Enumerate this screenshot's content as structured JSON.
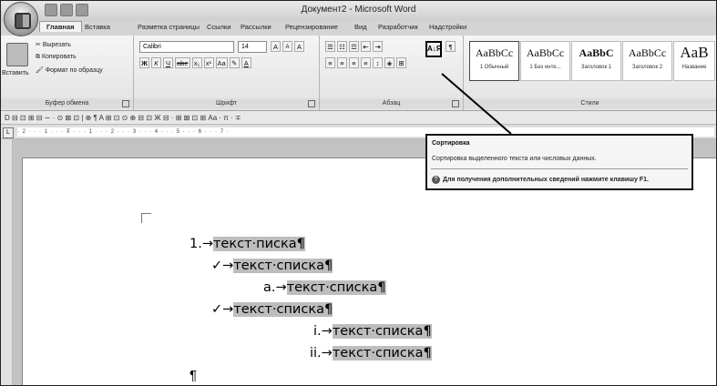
{
  "window": {
    "title": "Документ2 - Microsoft Word"
  },
  "tabs": [
    "Главная",
    "Вставка",
    "Разметка страницы",
    "Ссылки",
    "Рассылки",
    "Рецензирование",
    "Вид",
    "Разработчик",
    "Надстройки"
  ],
  "clipboard": {
    "paste": "Вставить",
    "cut": "Вырезать",
    "copy": "Копировать",
    "format_painter": "Формат по образцу",
    "label": "Буфер обмена"
  },
  "font": {
    "name": "Calibri",
    "size": "14",
    "bold": "Ж",
    "italic": "К",
    "underline": "Ч",
    "strike": "abe",
    "subscript": "x₁",
    "superscript": "x¹",
    "change_case": "Aa",
    "grow": "A",
    "shrink": "A",
    "clear": "A",
    "label": "Шрифт"
  },
  "paragraph": {
    "label": "Абзац",
    "sort": "А↓Я"
  },
  "styles": {
    "label": "Стили",
    "items": [
      {
        "preview": "AaBbCc",
        "name": "1 Обычный"
      },
      {
        "preview": "AaBbCc",
        "name": "1 Без инте..."
      },
      {
        "preview": "AaBbC",
        "name": "Заголовок 1"
      },
      {
        "preview": "AaBbCc",
        "name": "Заголовок 2"
      },
      {
        "preview": "AaB",
        "name": "Название"
      }
    ]
  },
  "format_toolbar": "D ⊟ ⊡ ⊞ ⊟ ∽ · ⊙ ⊠ ⊡ | ⊕ ¶ A ⊞ ⊡ ⊙ ⊕ ⊟ ⊡ Ж ⊟ · ⊞ ⊠ ⊡ ⊞ Aa · π · ∓",
  "ruler": "· 2 · · · 1 · · · ⊼ · · · 1 · · · 2 · · · 3 · · · 4 · · · 5 · · · 6 · · · 7 ·",
  "tooltip": {
    "title": "Сортировка",
    "description": "Сортировка выделенного текста или числовых данных.",
    "help": "Для получения дополнительных сведений нажмите клавишу F1."
  },
  "document": {
    "lines": [
      {
        "marker": "1.→",
        "text": "текст·писка¶"
      },
      {
        "marker": "✓→",
        "text": "текст·списка¶"
      },
      {
        "marker": "a.→",
        "text": "текст·списка¶"
      },
      {
        "marker": "✓→",
        "text": "текст·списка¶"
      },
      {
        "marker": "i.→",
        "text": "текст·списка¶"
      },
      {
        "marker": "ii.→",
        "text": "текст·списка¶"
      }
    ],
    "last_paragraph": "¶"
  }
}
